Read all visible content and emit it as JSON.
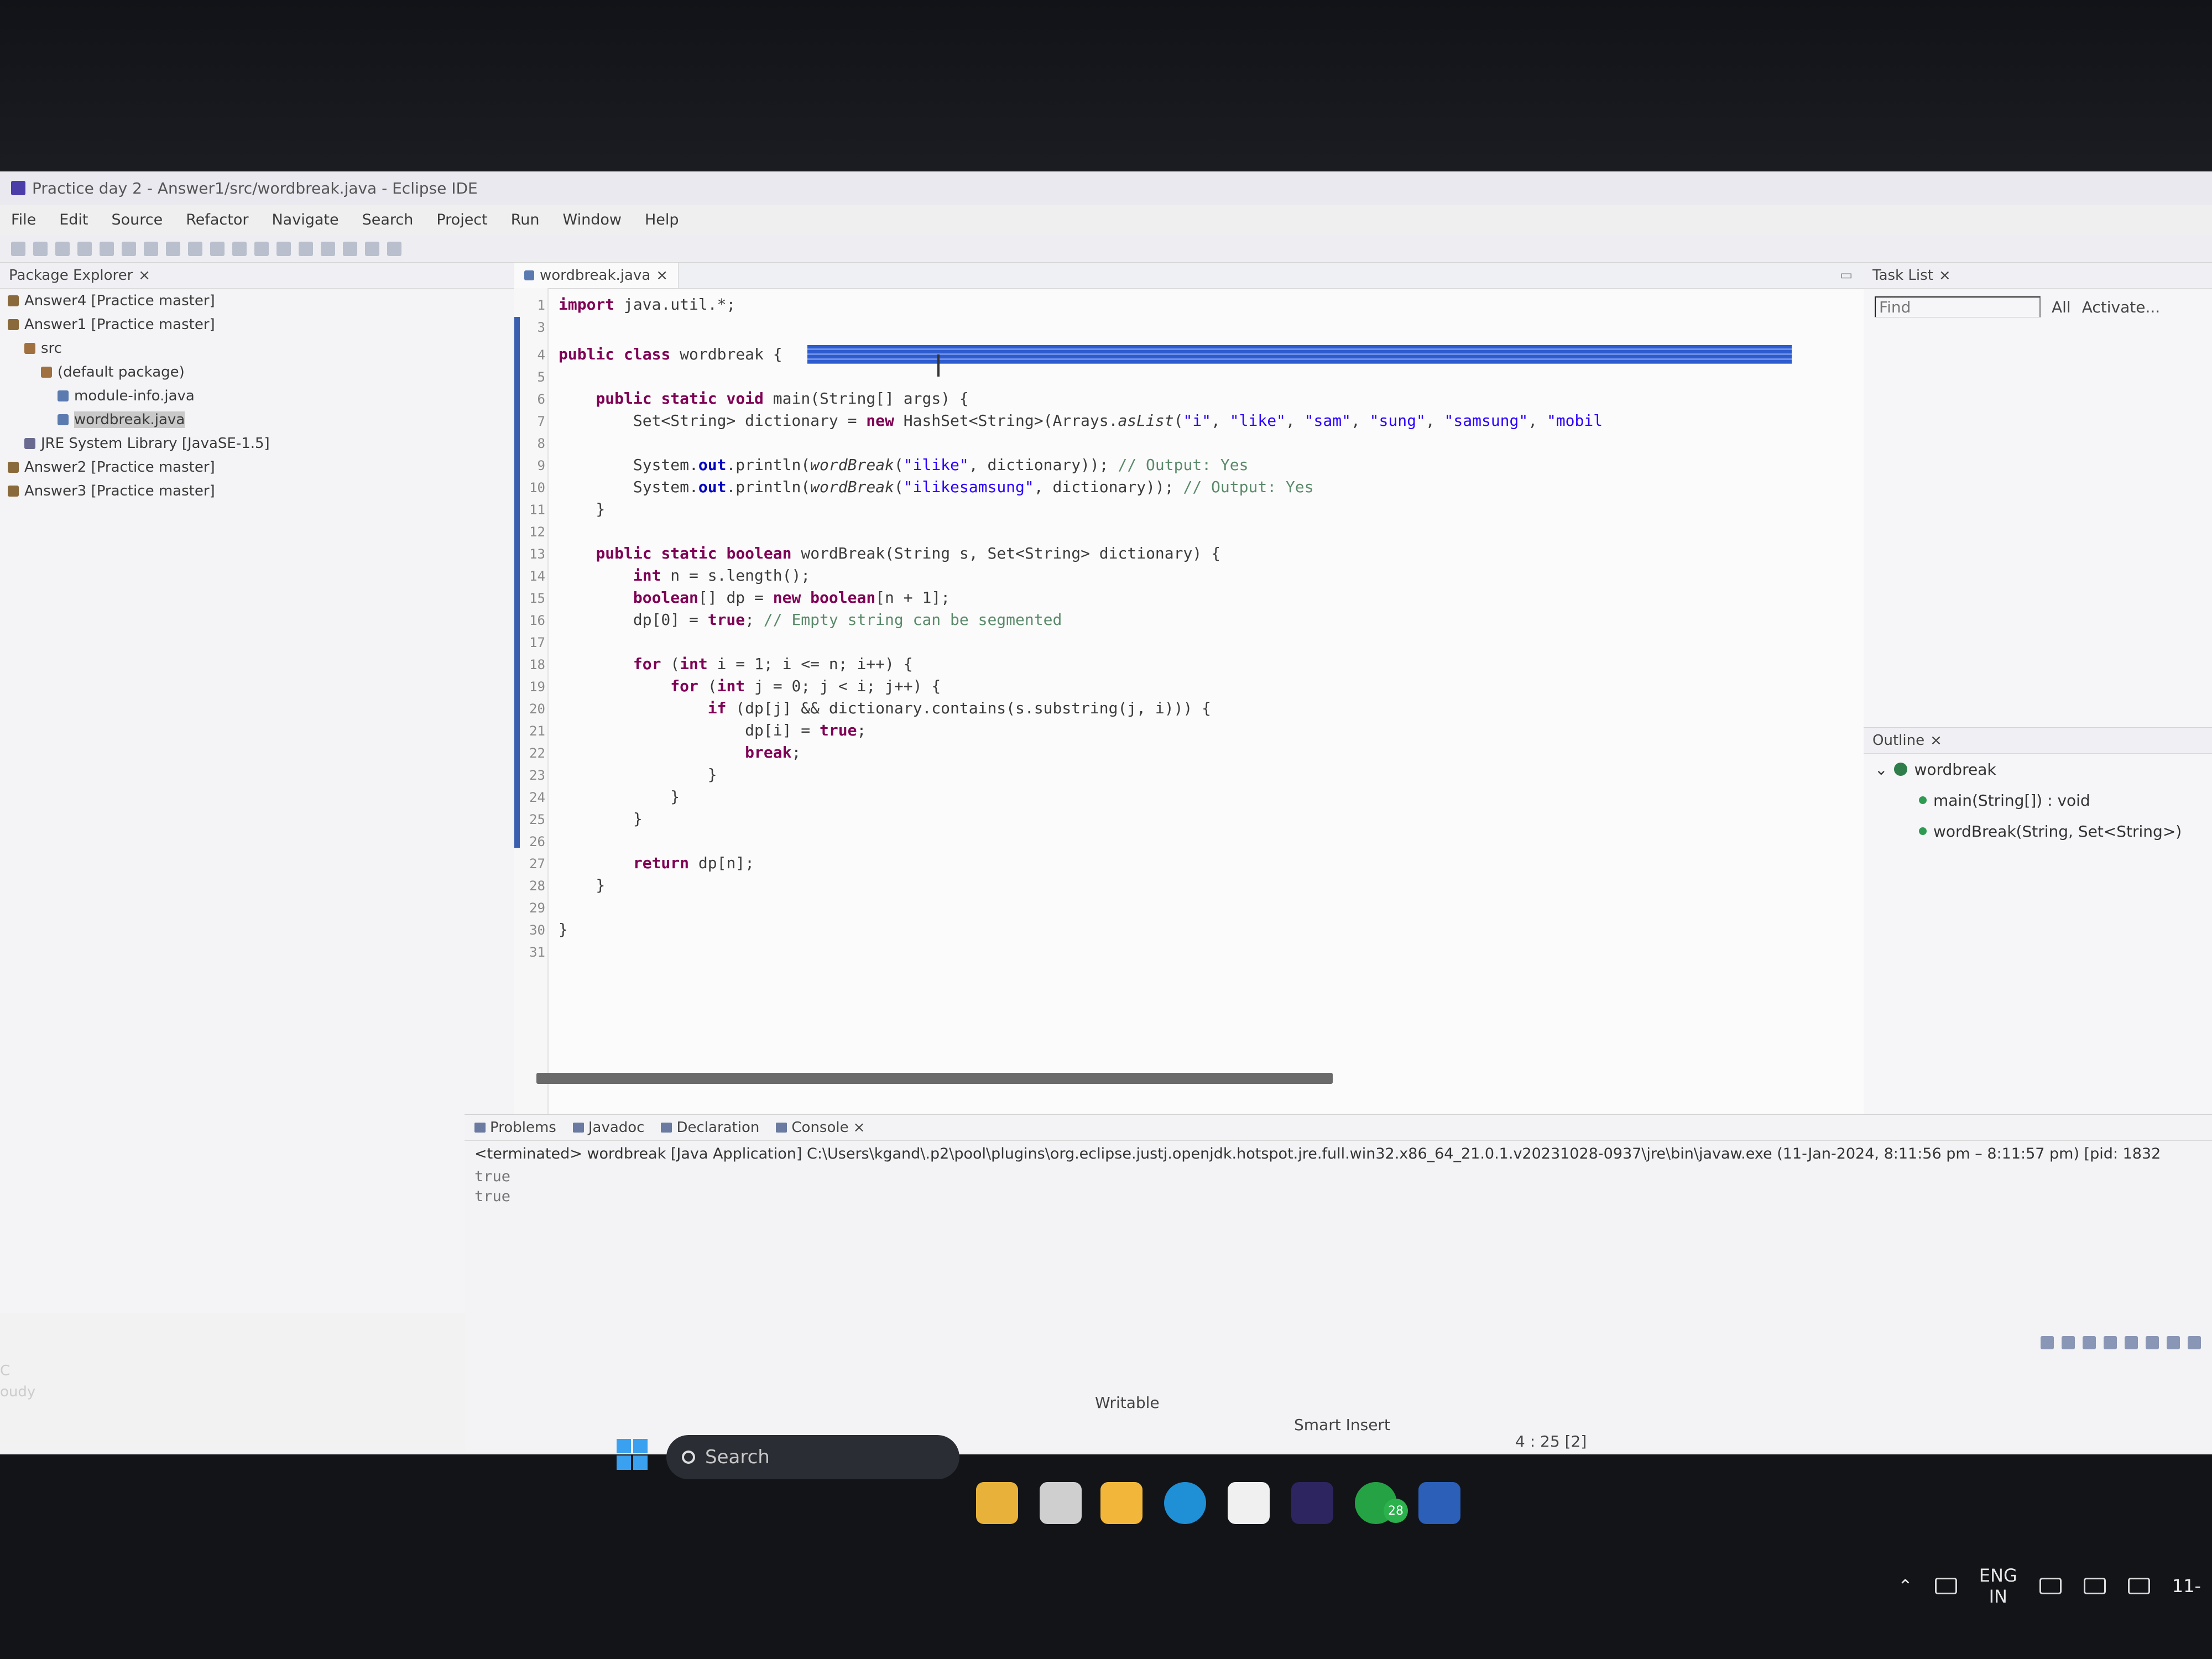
{
  "window": {
    "title": "Practice day 2 - Answer1/src/wordbreak.java - Eclipse IDE"
  },
  "menu": [
    "File",
    "Edit",
    "Source",
    "Refactor",
    "Navigate",
    "Search",
    "Project",
    "Run",
    "Window",
    "Help"
  ],
  "package_explorer": {
    "tab_label": "Package Explorer",
    "items": [
      {
        "label": "Answer4 [Practice master]"
      },
      {
        "label": "Answer1 [Practice master]"
      },
      {
        "label": "src"
      },
      {
        "label": "(default package)"
      },
      {
        "label": "module-info.java"
      },
      {
        "label": "wordbreak.java"
      },
      {
        "label": "JRE System Library [JavaSE-1.5]"
      },
      {
        "label": "Answer2 [Practice master]"
      },
      {
        "label": "Answer3 [Practice master]"
      }
    ]
  },
  "editor": {
    "tab_label": "wordbreak.java",
    "lines": [
      {
        "n": "1",
        "code": "import java.util.*;"
      },
      {
        "n": "3",
        "code": ""
      },
      {
        "n": "4",
        "code": "public class wordbreak {"
      },
      {
        "n": "5",
        "code": ""
      },
      {
        "n": "6",
        "code": "    public static void main(String[] args) {"
      },
      {
        "n": "7",
        "code": "        Set<String> dictionary = new HashSet<String>(Arrays.asList(\"i\", \"like\", \"sam\", \"sung\", \"samsung\", \"mobil"
      },
      {
        "n": "8",
        "code": ""
      },
      {
        "n": "9",
        "code": "        System.out.println(wordBreak(\"ilike\", dictionary)); // Output: Yes"
      },
      {
        "n": "10",
        "code": "        System.out.println(wordBreak(\"ilikesamsung\", dictionary)); // Output: Yes"
      },
      {
        "n": "11",
        "code": "    }"
      },
      {
        "n": "12",
        "code": ""
      },
      {
        "n": "13",
        "code": "    public static boolean wordBreak(String s, Set<String> dictionary) {"
      },
      {
        "n": "14",
        "code": "        int n = s.length();"
      },
      {
        "n": "15",
        "code": "        boolean[] dp = new boolean[n + 1];"
      },
      {
        "n": "16",
        "code": "        dp[0] = true; // Empty string can be segmented"
      },
      {
        "n": "17",
        "code": ""
      },
      {
        "n": "18",
        "code": "        for (int i = 1; i <= n; i++) {"
      },
      {
        "n": "19",
        "code": "            for (int j = 0; j < i; j++) {"
      },
      {
        "n": "20",
        "code": "                if (dp[j] && dictionary.contains(s.substring(j, i))) {"
      },
      {
        "n": "21",
        "code": "                    dp[i] = true;"
      },
      {
        "n": "22",
        "code": "                    break;"
      },
      {
        "n": "23",
        "code": "                }"
      },
      {
        "n": "24",
        "code": "            }"
      },
      {
        "n": "25",
        "code": "        }"
      },
      {
        "n": "26",
        "code": ""
      },
      {
        "n": "27",
        "code": "        return dp[n];"
      },
      {
        "n": "28",
        "code": "    }"
      },
      {
        "n": "29",
        "code": ""
      },
      {
        "n": "30",
        "code": "}"
      },
      {
        "n": "31",
        "code": ""
      }
    ]
  },
  "task_list": {
    "tab_label": "Task List",
    "find_placeholder": "Find",
    "all_label": "All",
    "activate_label": "Activate..."
  },
  "outline": {
    "tab_label": "Outline",
    "class_name": "wordbreak",
    "members": [
      {
        "label": "main(String[]) : void"
      },
      {
        "label": "wordBreak(String, Set<String>)"
      }
    ]
  },
  "console": {
    "tabs": [
      "Problems",
      "Javadoc",
      "Declaration",
      "Console"
    ],
    "header": "<terminated> wordbreak [Java Application] C:\\Users\\kgand\\.p2\\pool\\plugins\\org.eclipse.justj.openjdk.hotspot.jre.full.win32.x86_64_21.0.1.v20231028-0937\\jre\\bin\\javaw.exe  (11-Jan-2024, 8:11:56 pm – 8:11:57 pm) [pid: 1832",
    "output": [
      "true",
      "true"
    ]
  },
  "status": {
    "writable": "Writable",
    "insert_mode": "Smart Insert",
    "position": "4 : 25 [2]"
  },
  "taskbar": {
    "search_label": "Search",
    "whatsapp_badge": "28",
    "lang_top": "ENG",
    "lang_bottom": "IN",
    "clock": "11-"
  },
  "weather": {
    "line1": "C",
    "line2": "oudy"
  },
  "colors": {
    "keyword": "#7f0055",
    "string": "#2a00ff",
    "comment": "#5a8a6a",
    "selection": "#2d5bd0"
  }
}
